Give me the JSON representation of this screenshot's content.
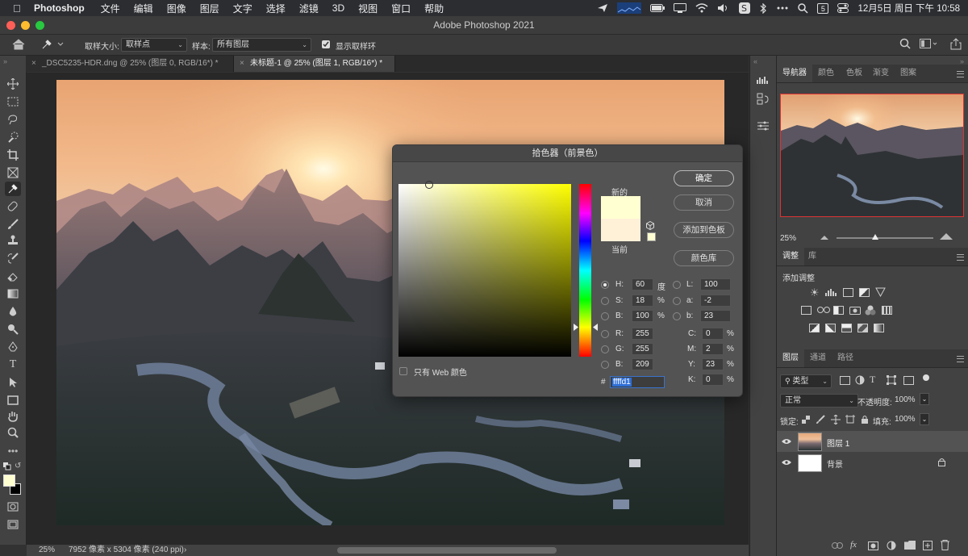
{
  "menubar": {
    "app": "Photoshop",
    "items": [
      "文件",
      "编辑",
      "图像",
      "图层",
      "文字",
      "选择",
      "滤镜",
      "3D",
      "视图",
      "窗口",
      "帮助"
    ],
    "datetime": "12月5日 周日 下午 10:58",
    "calendar_day": "5"
  },
  "window": {
    "title": "Adobe Photoshop 2021"
  },
  "options": {
    "sample_size_label": "取样大小:",
    "sample_size_value": "取样点",
    "sample_label": "样本:",
    "sample_value": "所有图层",
    "show_ring_label": "显示取样环",
    "show_ring_checked": true
  },
  "tabs": [
    {
      "label": "_DSC5235-HDR.dng @ 25% (图层 0, RGB/16*) *",
      "active": false
    },
    {
      "label": "未标题-1 @ 25% (图层 1, RGB/16*) *",
      "active": true
    }
  ],
  "status": {
    "zoom": "25%",
    "doc_info": "7952 像素 x 5304 像素 (240 ppi)"
  },
  "navigator": {
    "tabs": [
      "导航器",
      "颜色",
      "色板",
      "渐变",
      "图案"
    ],
    "zoom": "25%"
  },
  "adjustments": {
    "tabs": [
      "调整",
      "库"
    ],
    "add_label": "添加调整"
  },
  "layers_panel": {
    "tabs": [
      "图层",
      "通道",
      "路径"
    ],
    "filter_kind": "类型",
    "blend_mode": "正常",
    "opacity_label": "不透明度:",
    "opacity": "100%",
    "lock_label": "锁定:",
    "fill_label": "填充:",
    "fill": "100%",
    "layers": [
      {
        "name": "图层 1",
        "selected": true
      },
      {
        "name": "背景",
        "selected": false,
        "locked": true
      }
    ]
  },
  "color_picker": {
    "title": "拾色器（前景色）",
    "new_label": "新的",
    "current_label": "当前",
    "new_color": "#ffffd1",
    "current_color": "#fff0d8",
    "buttons": {
      "ok": "确定",
      "cancel": "取消",
      "add_swatch": "添加到色板",
      "libraries": "颜色库"
    },
    "web_only_label": "只有 Web 颜色",
    "hsb": {
      "H": "60",
      "H_unit": "度",
      "S": "18",
      "S_unit": "%",
      "B": "100",
      "B_unit": "%"
    },
    "lab": {
      "L": "100",
      "a": "-2",
      "b": "23"
    },
    "rgb": {
      "R": "255",
      "G": "255",
      "B": "209"
    },
    "cmyk": {
      "C": "0",
      "M": "2",
      "Y": "23",
      "K": "0",
      "unit": "%"
    },
    "hex_label": "#",
    "hex": "ffffd1"
  },
  "colors": {
    "foreground": "#ffffd1",
    "background": "#000000",
    "accent_selection": "#2f6fd6"
  }
}
